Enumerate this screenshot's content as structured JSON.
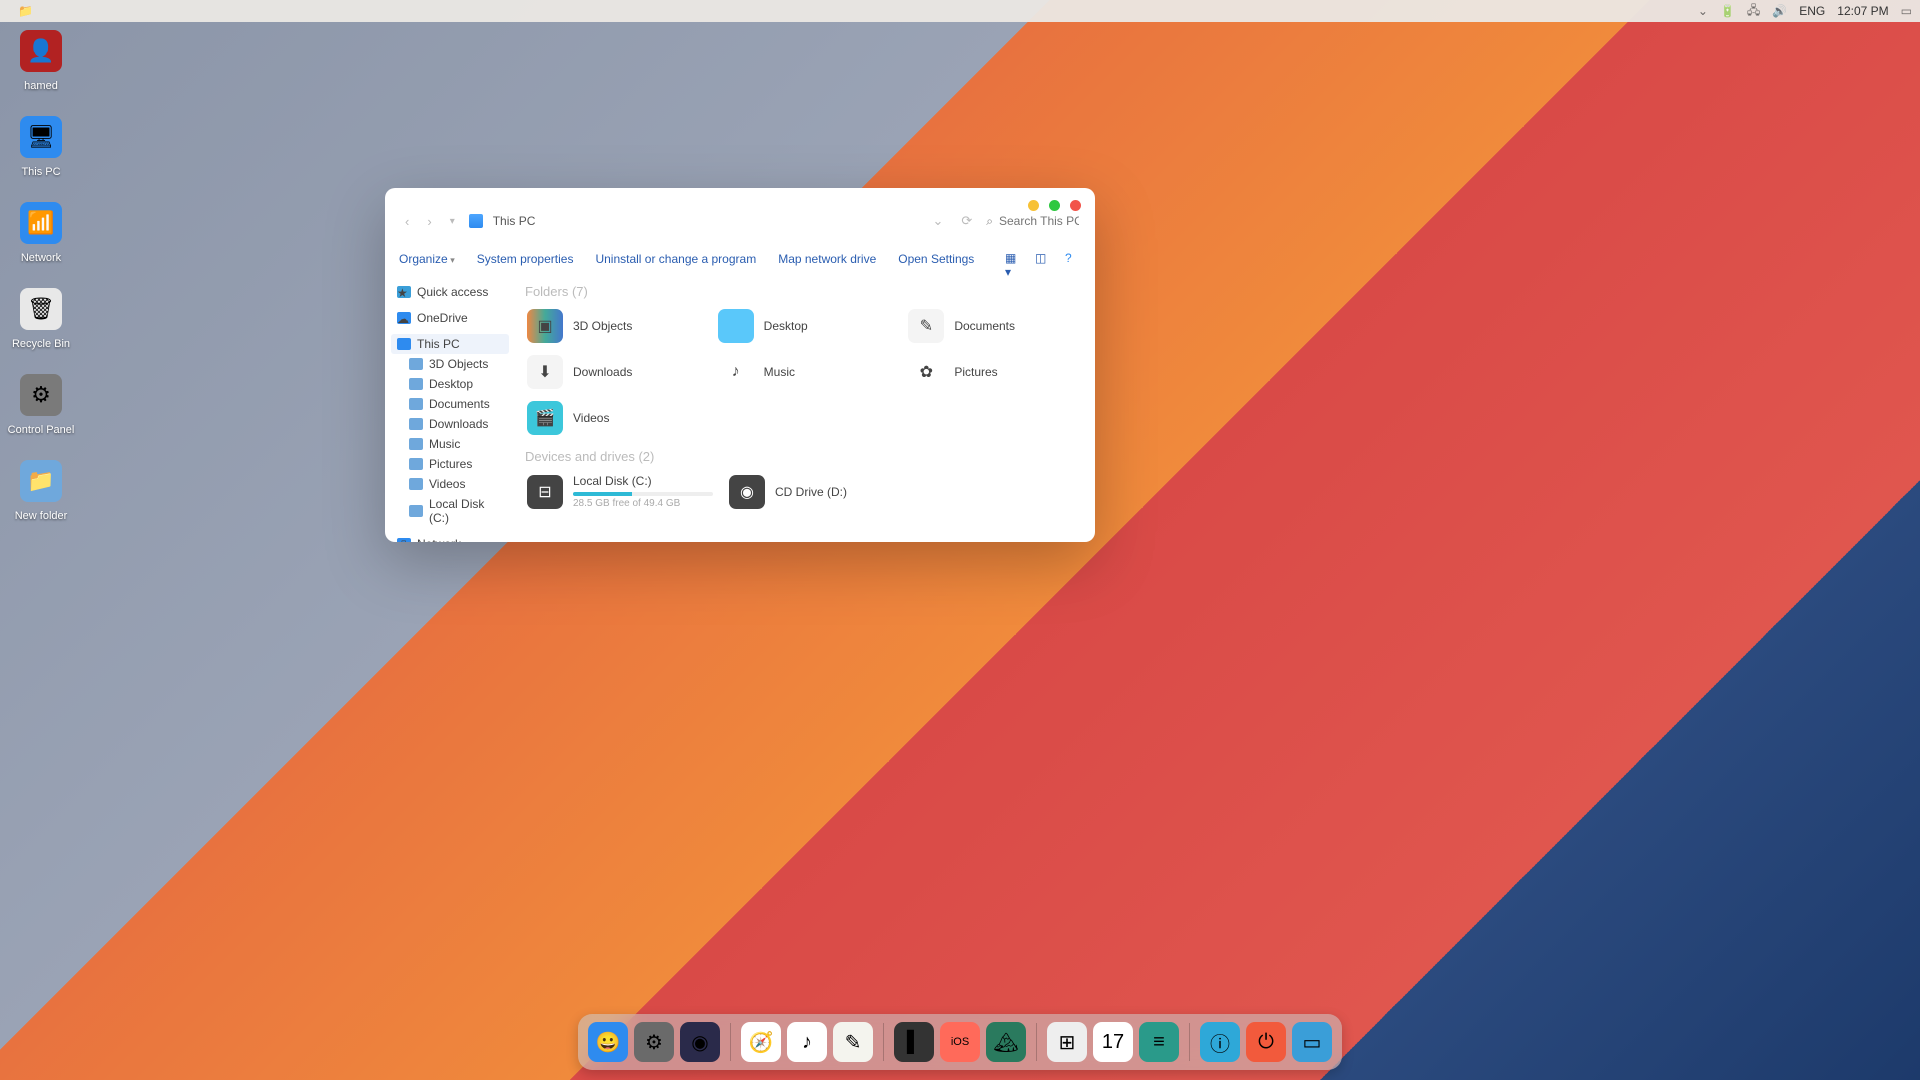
{
  "menubar": {
    "lang": "ENG",
    "time": "12:07 PM"
  },
  "desktop": [
    {
      "name": "hamed",
      "label": "hamed",
      "bg": "#b22222",
      "glyph": "👤"
    },
    {
      "name": "this-pc",
      "label": "This PC",
      "bg": "#2e8bef",
      "glyph": "🖥"
    },
    {
      "name": "network",
      "label": "Network",
      "bg": "#2e8bef",
      "glyph": "📶"
    },
    {
      "name": "recycle-bin",
      "label": "Recycle Bin",
      "bg": "#e8e8e8",
      "glyph": "🗑"
    },
    {
      "name": "control-panel",
      "label": "Control Panel",
      "bg": "#7a7a7a",
      "glyph": "⚙"
    },
    {
      "name": "new-folder",
      "label": "New folder",
      "bg": "#6fa8dc",
      "glyph": "📁"
    }
  ],
  "window": {
    "location": "This PC",
    "search_placeholder": "Search This PC",
    "toolbar": {
      "organize": "Organize",
      "sysprops": "System properties",
      "uninstall": "Uninstall or change a program",
      "mapnet": "Map network drive",
      "settings": "Open Settings"
    },
    "sidebar": {
      "quick": "Quick access",
      "onedrive": "OneDrive",
      "thispc": "This PC",
      "sub": [
        {
          "label": "3D Objects"
        },
        {
          "label": "Desktop"
        },
        {
          "label": "Documents"
        },
        {
          "label": "Downloads"
        },
        {
          "label": "Music"
        },
        {
          "label": "Pictures"
        },
        {
          "label": "Videos"
        },
        {
          "label": "Local Disk (C:)"
        }
      ],
      "network": "Network"
    },
    "sections": {
      "folders_h": "Folders (7)",
      "drives_h": "Devices and drives (2)"
    },
    "folders": [
      {
        "name": "3d-objects",
        "label": "3D Objects",
        "bg": "linear-gradient(90deg,#e84,#4a9,#47c)"
      },
      {
        "name": "desktop",
        "label": "Desktop",
        "bg": "#5ac8fa"
      },
      {
        "name": "documents",
        "label": "Documents",
        "bg": "#f4f4f4"
      },
      {
        "name": "downloads",
        "label": "Downloads",
        "bg": "#f4f4f4"
      },
      {
        "name": "music",
        "label": "Music",
        "bg": "#fff"
      },
      {
        "name": "pictures",
        "label": "Pictures",
        "bg": "#fff"
      },
      {
        "name": "videos",
        "label": "Videos",
        "bg": "#3cc7db"
      }
    ],
    "drives": [
      {
        "name": "local-disk-c",
        "label": "Local Disk (C:)",
        "meta": "28.5 GB free of 49.4 GB",
        "pct": 42
      },
      {
        "name": "cd-drive-d",
        "label": "CD Drive (D:)"
      }
    ]
  },
  "dock": [
    {
      "name": "finder",
      "bg": "#2e8bef",
      "glyph": "😀"
    },
    {
      "name": "settings",
      "bg": "#6a6a6a",
      "glyph": "⚙"
    },
    {
      "name": "siri",
      "bg": "#2a2a4a",
      "glyph": "◉"
    },
    {
      "sep": true
    },
    {
      "name": "safari",
      "bg": "#fff",
      "glyph": "🧭"
    },
    {
      "name": "music",
      "bg": "#fff",
      "glyph": "♪"
    },
    {
      "name": "notes",
      "bg": "#f4f4ee",
      "glyph": "✎"
    },
    {
      "sep": true
    },
    {
      "name": "terminal",
      "bg": "#333",
      "glyph": "▌"
    },
    {
      "name": "ios",
      "bg": "#ff6a5a",
      "glyph": "iOS"
    },
    {
      "name": "wallpaper",
      "bg": "#2a7a5e",
      "glyph": "🏔"
    },
    {
      "sep": true
    },
    {
      "name": "launchpad",
      "bg": "#eee",
      "glyph": "⊞"
    },
    {
      "name": "calendar",
      "bg": "#fff",
      "glyph": "17"
    },
    {
      "name": "tasks",
      "bg": "#2a9a8a",
      "glyph": "≡"
    },
    {
      "sep": true
    },
    {
      "name": "info",
      "bg": "#2ea8d8",
      "glyph": "ⓘ"
    },
    {
      "name": "power",
      "bg": "#f25a3c",
      "glyph": "⏻"
    },
    {
      "name": "desktop-show",
      "bg": "#3a9ed8",
      "glyph": "▭"
    }
  ]
}
